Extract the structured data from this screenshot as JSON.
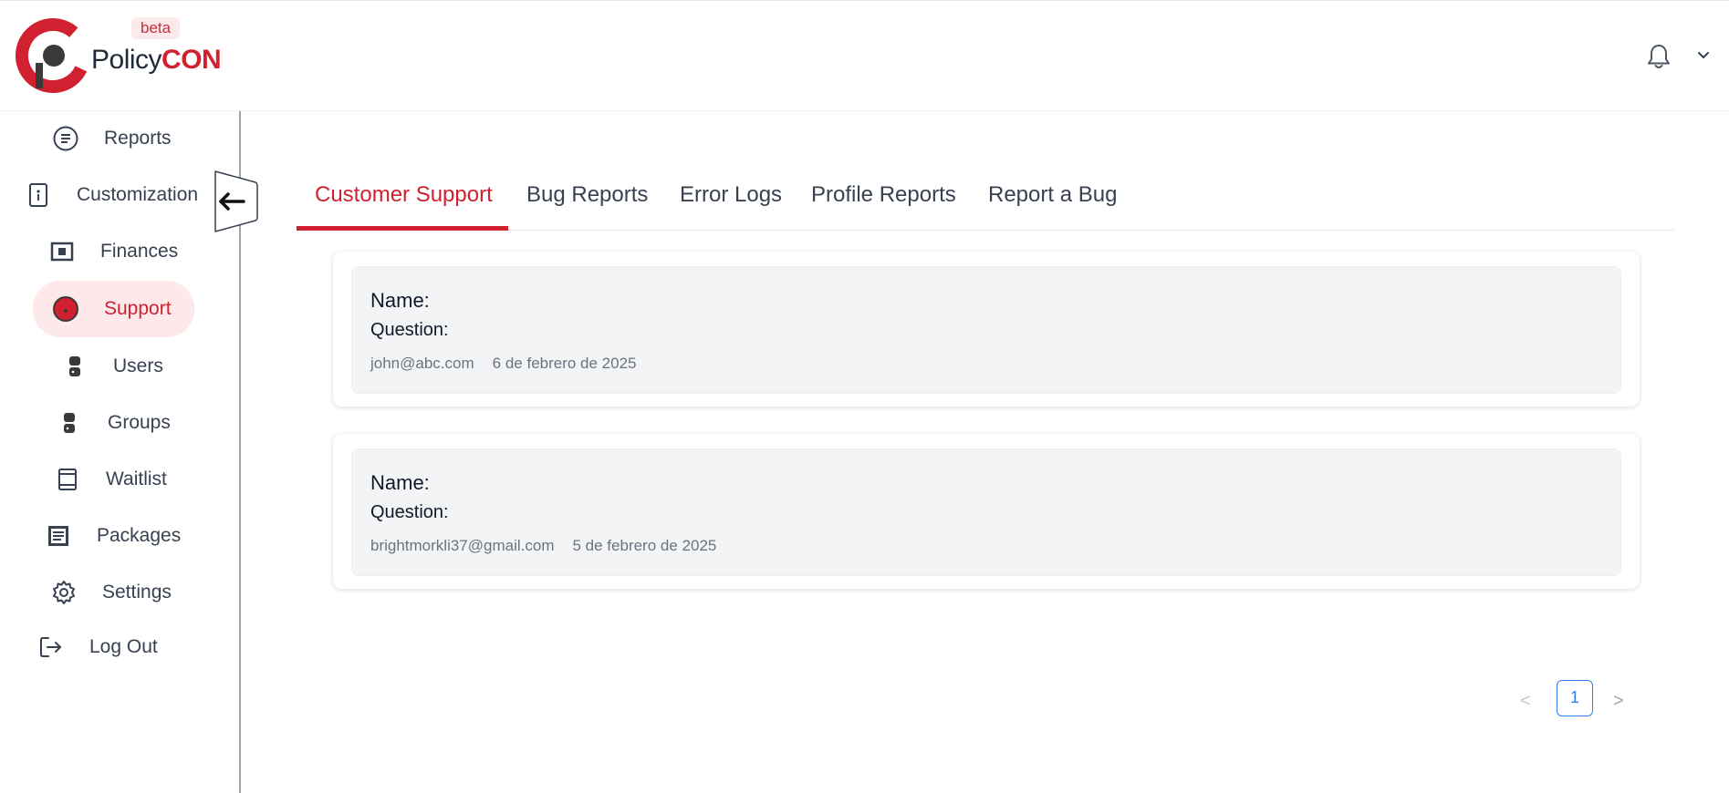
{
  "brand": {
    "name_part1": "Policy",
    "name_part2": "CON",
    "badge": "beta",
    "accent_color": "#d1202f"
  },
  "header": {
    "notifications_icon": "bell-icon",
    "menu_icon": "chevron-down-icon"
  },
  "sidebar": {
    "items": [
      {
        "label": "Reports",
        "icon": "reports-icon"
      },
      {
        "label": "Customization",
        "icon": "customization-icon"
      },
      {
        "label": "Finances",
        "icon": "finances-icon"
      },
      {
        "label": "Support",
        "icon": "support-icon",
        "active": true
      },
      {
        "label": "Users",
        "icon": "users-icon"
      },
      {
        "label": "Groups",
        "icon": "groups-icon"
      },
      {
        "label": "Waitlist",
        "icon": "waitlist-icon"
      },
      {
        "label": "Packages",
        "icon": "packages-icon"
      },
      {
        "label": "Settings",
        "icon": "gear-icon"
      },
      {
        "label": "Log Out",
        "icon": "logout-icon"
      }
    ],
    "collapse_icon": "arrow-left-icon"
  },
  "tabs": [
    {
      "label": "Customer Support",
      "active": true
    },
    {
      "label": "Bug Reports"
    },
    {
      "label": "Error Logs"
    },
    {
      "label": "Profile Reports"
    },
    {
      "label": "Report a Bug"
    }
  ],
  "tickets": [
    {
      "name_label": "Name:",
      "question_label": "Question:",
      "email": "john@abc.com",
      "date": "6 de febrero de 2025"
    },
    {
      "name_label": "Name:",
      "question_label": "Question:",
      "email": "brightmorkli37@gmail.com",
      "date": "5 de febrero de 2025"
    }
  ],
  "pagination": {
    "prev": "<",
    "current_page": "1",
    "next": ">"
  }
}
